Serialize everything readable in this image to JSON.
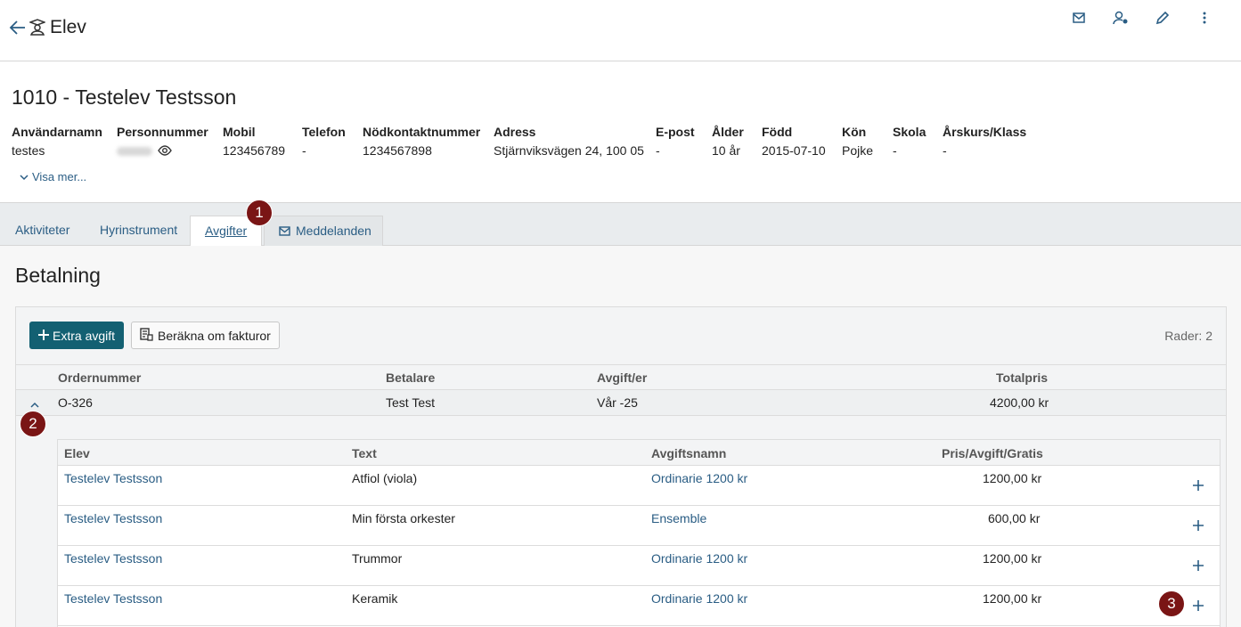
{
  "header": {
    "title": "Elev"
  },
  "student": {
    "title": "1010 - Testelev Testsson",
    "fields": [
      {
        "label": "Användarnamn",
        "value": "testes"
      },
      {
        "label": "Personnummer",
        "value": ""
      },
      {
        "label": "Mobil",
        "value": "123456789"
      },
      {
        "label": "Telefon",
        "value": "-"
      },
      {
        "label": "Nödkontaktnummer",
        "value": "1234567898"
      },
      {
        "label": "Adress",
        "value": "Stjärnviksvägen 24, 100 05"
      },
      {
        "label": "E-post",
        "value": "-"
      },
      {
        "label": "Ålder",
        "value": "10 år"
      },
      {
        "label": "Född",
        "value": "2015-07-10"
      },
      {
        "label": "Kön",
        "value": "Pojke"
      },
      {
        "label": "Skola",
        "value": "-"
      },
      {
        "label": "Årskurs/Klass",
        "value": "-"
      }
    ],
    "show_more": "Visa mer..."
  },
  "tabs": [
    {
      "label": "Aktiviteter"
    },
    {
      "label": "Hyrinstrument"
    },
    {
      "label": "Avgifter"
    },
    {
      "label": "Meddelanden"
    }
  ],
  "badges": {
    "one": "1",
    "two": "2",
    "three": "3"
  },
  "payment": {
    "title": "Betalning",
    "extra_fee_button": "Extra avgift",
    "recalc_button": "Beräkna om fakturor",
    "rows_count": "Rader: 2",
    "columns": [
      "Ordernummer",
      "Betalare",
      "Avgift/er",
      "Totalpris"
    ],
    "order": {
      "number": "O-326",
      "payer": "Test Test",
      "fees": "Vår -25",
      "total": "4200,00 kr"
    },
    "sub_columns": [
      "Elev",
      "Text",
      "Avgiftsnamn",
      "Pris/Avgift/Gratis"
    ],
    "items": [
      {
        "student": "Testelev Testsson",
        "text": "Atfiol (viola)",
        "fee_name": "Ordinarie 1200 kr",
        "price": "1200,00 kr"
      },
      {
        "student": "Testelev Testsson",
        "text": "Min första orkester",
        "fee_name": "Ensemble",
        "price": "600,00 kr"
      },
      {
        "student": "Testelev Testsson",
        "text": "Trummor",
        "fee_name": "Ordinarie 1200 kr",
        "price": "1200,00 kr"
      },
      {
        "student": "Testelev Testsson",
        "text": "Keramik",
        "fee_name": "Ordinarie 1200 kr",
        "price": "1200,00 kr"
      }
    ]
  },
  "colors": {
    "primary": "#136072",
    "link": "#2a5d84",
    "badge": "#7a1515"
  }
}
